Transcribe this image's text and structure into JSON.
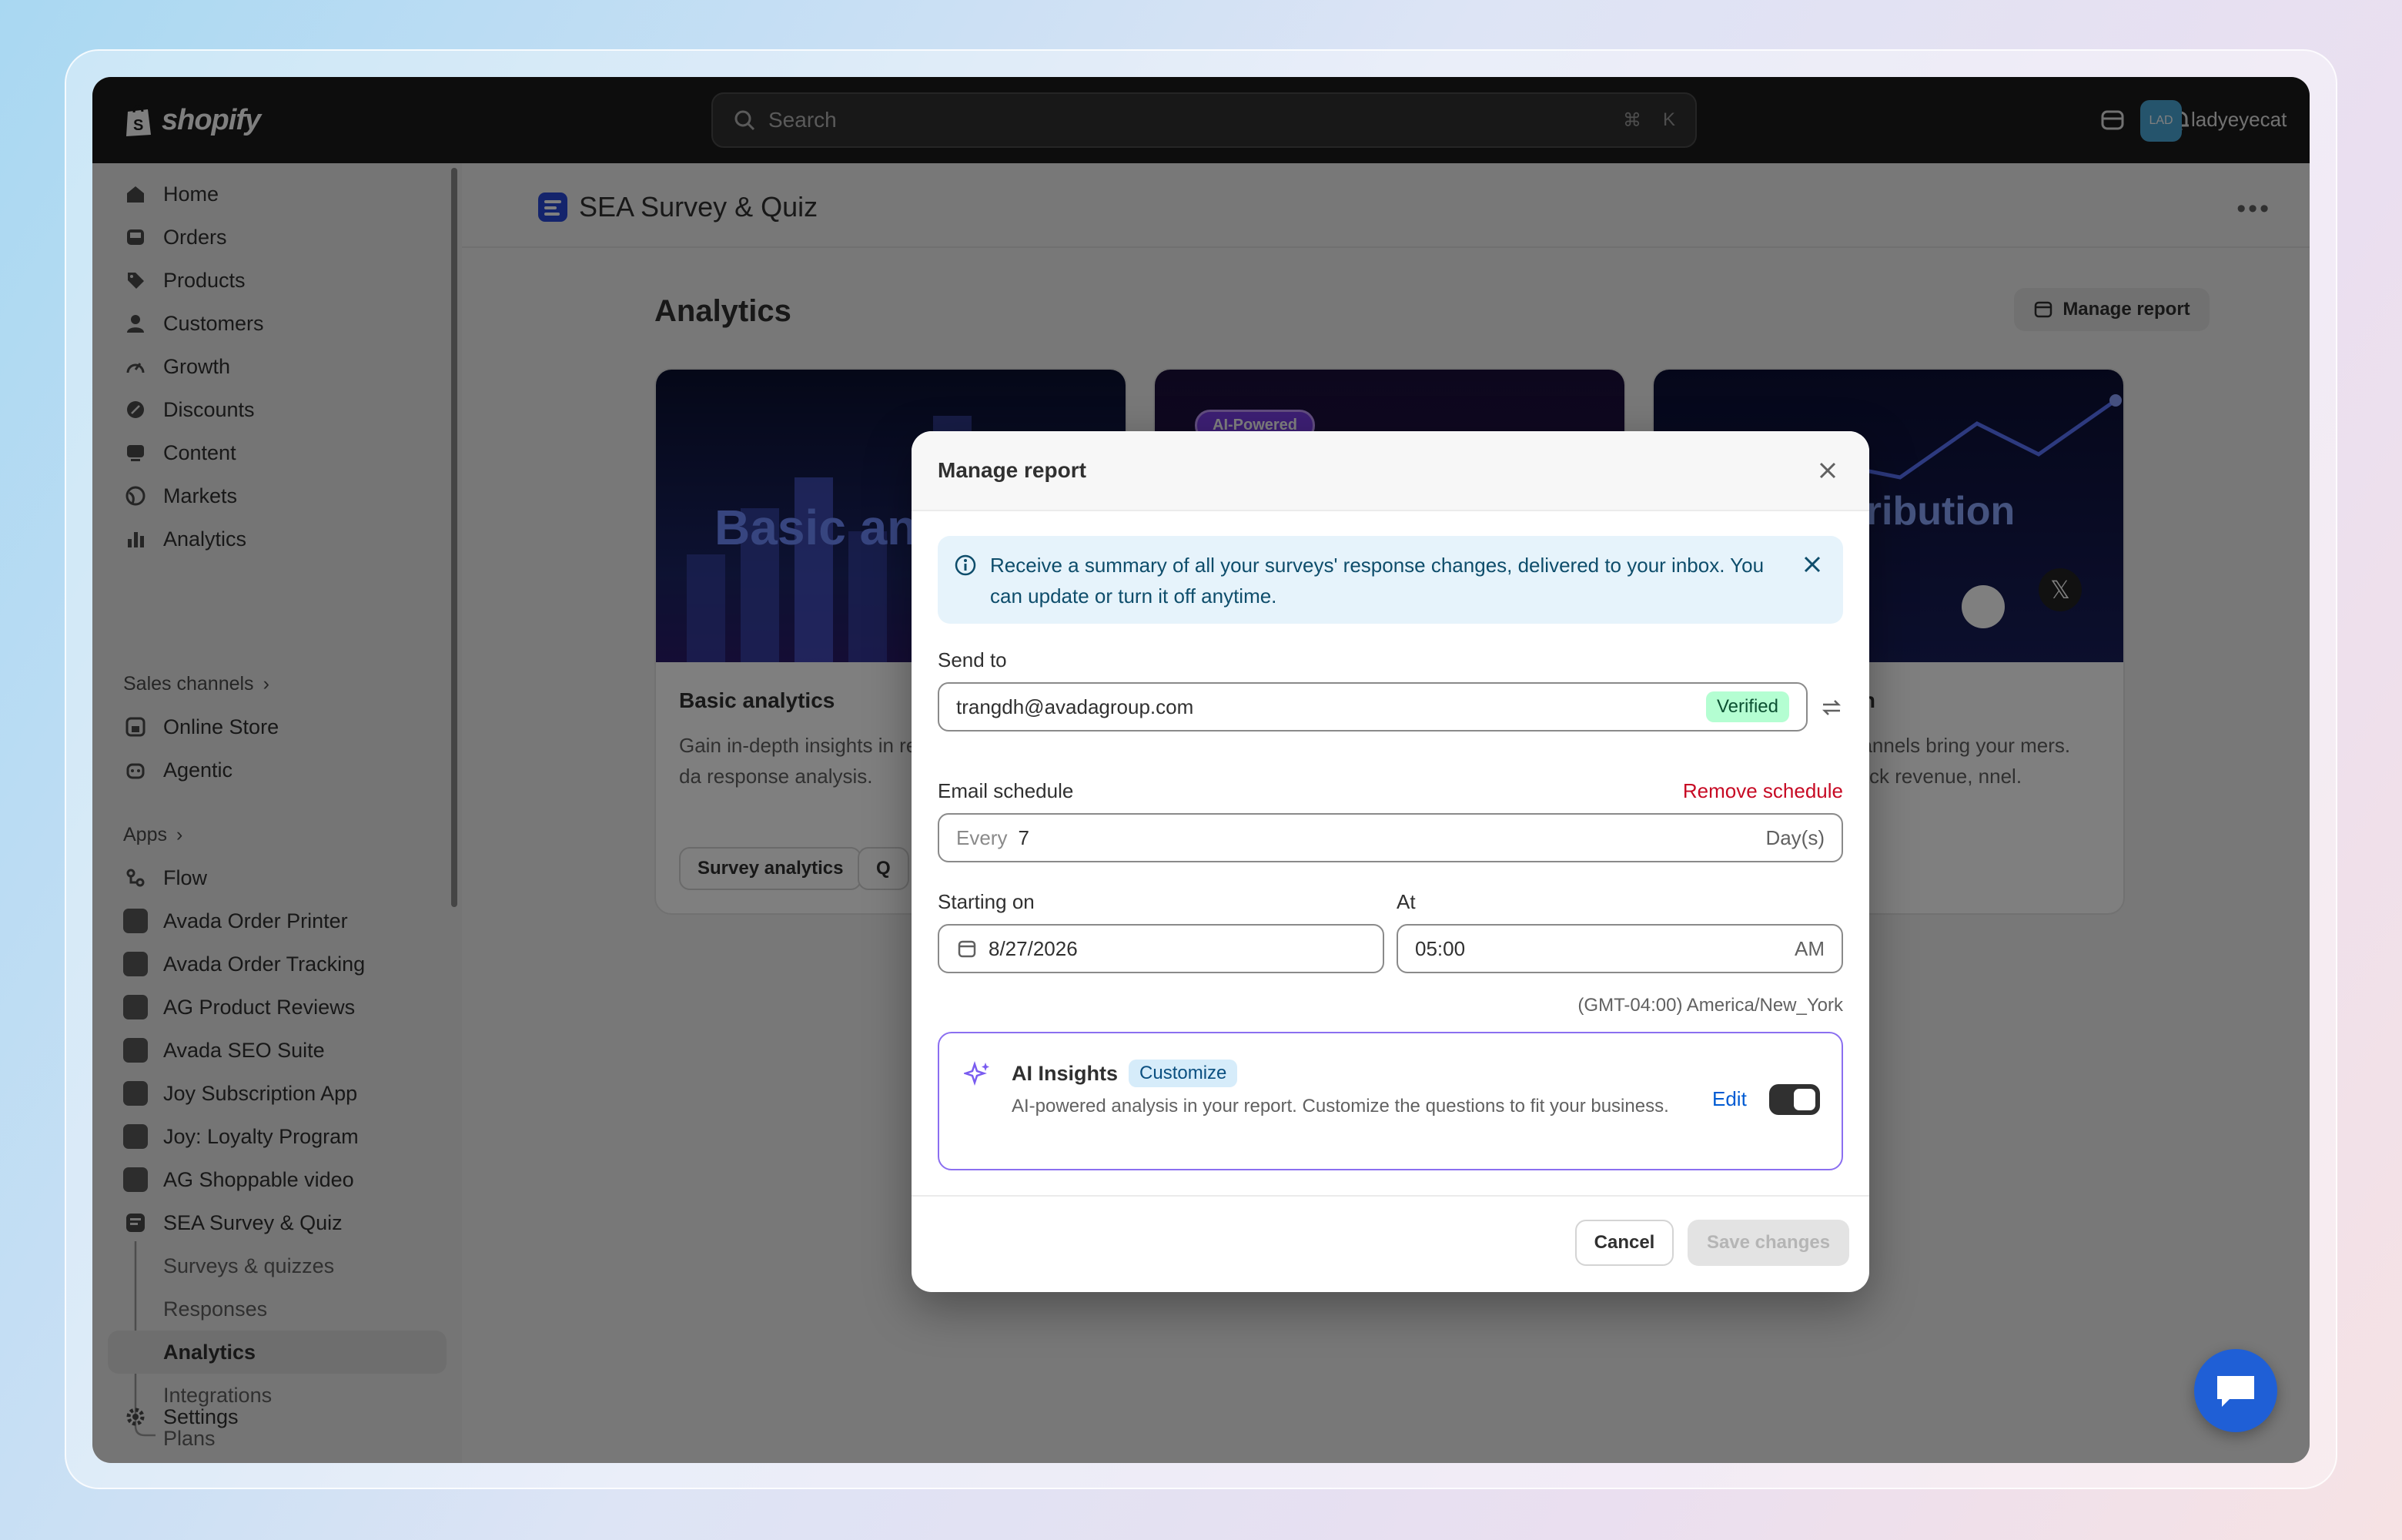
{
  "topbar": {
    "brand": "shopify",
    "search_placeholder": "Search",
    "shortcut_cmd": "⌘",
    "shortcut_key": "K",
    "avatar_initials": "LAD",
    "username": "ladyeyecat"
  },
  "sidebar": {
    "main_items": [
      {
        "label": "Home",
        "icon": "home-icon"
      },
      {
        "label": "Orders",
        "icon": "inbox-icon"
      },
      {
        "label": "Products",
        "icon": "tag-icon"
      },
      {
        "label": "Customers",
        "icon": "person-icon"
      },
      {
        "label": "Growth",
        "icon": "gauge-icon"
      },
      {
        "label": "Discounts",
        "icon": "discount-icon"
      },
      {
        "label": "Content",
        "icon": "content-icon"
      },
      {
        "label": "Markets",
        "icon": "globe-icon"
      },
      {
        "label": "Analytics",
        "icon": "bar-chart-icon"
      }
    ],
    "sales_channels_heading": "Sales channels",
    "sales_channels": [
      {
        "label": "Online Store",
        "icon": "store-icon"
      },
      {
        "label": "Agentic",
        "icon": "robot-icon"
      }
    ],
    "apps_heading": "Apps",
    "apps": [
      {
        "label": "Flow",
        "icon": "flow-icon"
      },
      {
        "label": "Avada Order Printer",
        "icon": "app-icon"
      },
      {
        "label": "Avada Order Tracking",
        "icon": "app-icon"
      },
      {
        "label": "AG Product Reviews",
        "icon": "app-icon"
      },
      {
        "label": "Avada SEO Suite",
        "icon": "app-icon"
      },
      {
        "label": "Joy Subscription App",
        "icon": "app-icon"
      },
      {
        "label": "Joy: Loyalty Program",
        "icon": "app-icon"
      },
      {
        "label": "AG Shoppable video",
        "icon": "app-icon"
      },
      {
        "label": "SEA Survey & Quiz",
        "icon": "survey-app-icon"
      }
    ],
    "sub_items": [
      "Surveys & quizzes",
      "Responses",
      "Analytics",
      "Integrations",
      "Plans"
    ],
    "settings": "Settings"
  },
  "page": {
    "app_title": "SEA Survey & Quiz",
    "title": "Analytics",
    "manage_report_button": "Manage report",
    "cards": [
      {
        "banner_text": "Basic analytics",
        "banner_visible": "Basic an",
        "title": "Basic analytics",
        "desc": "Gain in-depth insights in results with real-time da response analysis.",
        "chip1": "Survey analytics",
        "chip2": "Q"
      },
      {
        "badge": "AI-Powered"
      },
      {
        "banner_visible": "g attribution",
        "title": "ion",
        "desc": "channels bring your mers. Track revenue, nnel."
      }
    ]
  },
  "modal": {
    "title": "Manage report",
    "info_banner": "Receive a summary of all your surveys' response changes, delivered to your inbox. You can update or turn it off anytime.",
    "send_to_label": "Send to",
    "send_to_value": "trangdh@avadagroup.com",
    "verified_badge": "Verified",
    "schedule_label": "Email schedule",
    "remove_schedule": "Remove schedule",
    "every_prefix": "Every",
    "every_value": "7",
    "every_unit": "Day(s)",
    "starting_label": "Starting on",
    "starting_value": "8/27/2026",
    "at_label": "At",
    "at_value": "05:00",
    "at_period": "AM",
    "timezone": "(GMT-04:00) America/New_York",
    "ai_title": "AI Insights",
    "ai_badge": "Customize",
    "ai_desc": "AI-powered analysis in your report. Customize the questions to fit your business.",
    "ai_edit": "Edit",
    "ai_enabled": true,
    "cancel": "Cancel",
    "save": "Save changes"
  },
  "colors": {
    "accent": "#005bd3",
    "danger": "#c70a24",
    "ai_border": "#8b6ff0",
    "verified_bg": "#b4fed2"
  }
}
